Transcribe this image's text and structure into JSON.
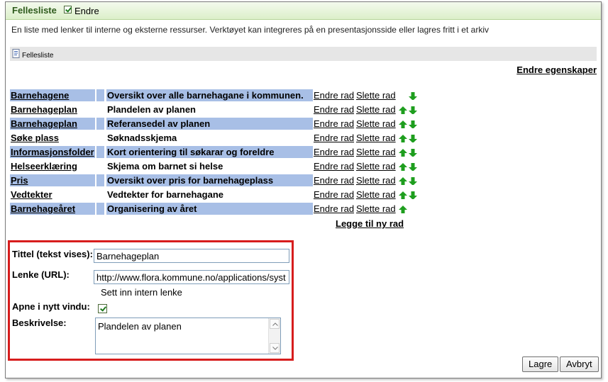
{
  "header": {
    "title": "Fellesliste",
    "edit_toggle_label": "Endre",
    "edit_toggle_checked": true
  },
  "description": "En liste med lenker til interne og eksterne ressurser. Verktøyet kan integreres på en presentasjonsside eller lagres fritt i et arkiv",
  "toolbar": {
    "icon": "document-icon",
    "label": "Fellesliste"
  },
  "edit_properties_link": "Endre egenskaper",
  "rows": [
    {
      "title": "Barnehagene",
      "desc": "Oversikt over alle barnehagane i kommunen.",
      "edit": "Endre rad",
      "delete": "Slette rad",
      "up": false,
      "down": true
    },
    {
      "title": "Barnehageplan",
      "desc": "Plandelen av planen",
      "edit": "Endre rad",
      "delete": "Slette rad",
      "up": true,
      "down": true
    },
    {
      "title": "Barnehageplan",
      "desc": "Referansedel av planen",
      "edit": "Endre rad",
      "delete": "Slette rad",
      "up": true,
      "down": true
    },
    {
      "title": "Søke plass",
      "desc": "Søknadsskjema",
      "edit": "Endre rad",
      "delete": "Slette rad",
      "up": true,
      "down": true
    },
    {
      "title": "Informasjonsfolder",
      "desc": "Kort orientering til søkarar og foreldre",
      "edit": "Endre rad",
      "delete": "Slette rad",
      "up": true,
      "down": true
    },
    {
      "title": "Helseerklæring",
      "desc": "Skjema om barnet si helse",
      "edit": "Endre rad",
      "delete": "Slette rad",
      "up": true,
      "down": true
    },
    {
      "title": "Pris",
      "desc": "Oversikt over pris for barnehageplass",
      "edit": "Endre rad",
      "delete": "Slette rad",
      "up": true,
      "down": true
    },
    {
      "title": "Vedtekter",
      "desc": "Vedtekter for barnehagane",
      "edit": "Endre rad",
      "delete": "Slette rad",
      "up": true,
      "down": true
    },
    {
      "title": "Barnehageåret",
      "desc": "Organisering av året",
      "edit": "Endre rad",
      "delete": "Slette rad",
      "up": true,
      "down": false
    }
  ],
  "add_row_link": "Legge til ny rad",
  "form": {
    "title_label": "Tittel (tekst vises):",
    "title_value": "Barnehageplan",
    "url_label": "Lenke (URL):",
    "url_value": "http://www.flora.kommune.no/applications/syst",
    "intern_link": "Sett inn intern lenke",
    "new_window_label": "Apne i nytt vindu:",
    "new_window_checked": true,
    "desc_label": "Beskrivelse:",
    "desc_value": "Plandelen av planen"
  },
  "buttons": {
    "save": "Lagre",
    "cancel": "Avbryt"
  },
  "colors": {
    "header_gradient_top": "#f4faee",
    "header_gradient_bottom": "#dcefc9",
    "row_highlight": "#a8bfe6",
    "arrow_green": "#1e9e1e",
    "form_border": "#d71d1d"
  }
}
